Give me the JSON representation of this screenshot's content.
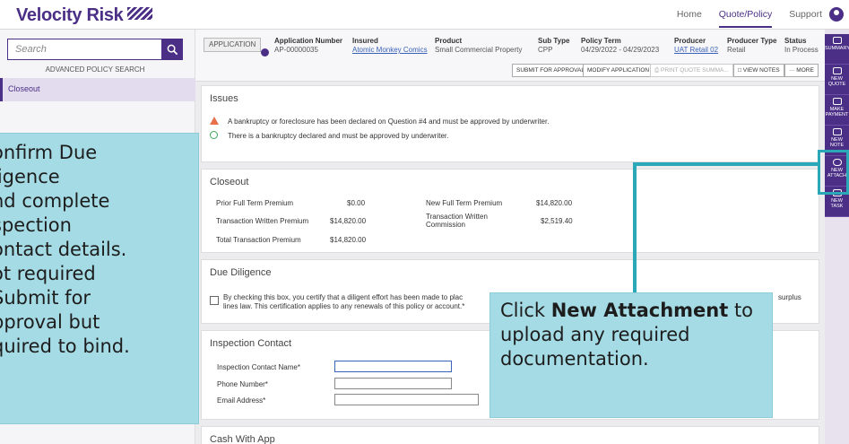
{
  "brand": {
    "name": "Velocity Risk"
  },
  "topnav": {
    "home": "Home",
    "quote_policy": "Quote/Policy",
    "support": "Support"
  },
  "sidebar": {
    "search_placeholder": "Search",
    "advanced_search": "ADVANCED POLICY SEARCH",
    "items": [
      {
        "label": "Closeout"
      }
    ]
  },
  "header": {
    "badge": "APPLICATION",
    "application_number": {
      "label": "Application Number",
      "value": "AP-00000035"
    },
    "insured": {
      "label": "Insured",
      "value": "Atomic Monkey Comics"
    },
    "product": {
      "label": "Product",
      "value": "Small Commercial Property"
    },
    "sub_type": {
      "label": "Sub Type",
      "value": "CPP"
    },
    "policy_term": {
      "label": "Policy Term",
      "value": "04/29/2022 - 04/29/2023"
    },
    "producer": {
      "label": "Producer",
      "value": "UAT Retail 02"
    },
    "producer_type": {
      "label": "Producer Type",
      "value": "Retail"
    },
    "status": {
      "label": "Status",
      "value": "In Process"
    }
  },
  "actions": {
    "submit": "SUBMIT FOR APPROVAL",
    "modify": "MODIFY APPLICATION",
    "print": "PRINT QUOTE SUMMA...",
    "view_notes": "VIEW NOTES",
    "more": "··· MORE"
  },
  "issues": {
    "title": "Issues",
    "items": [
      {
        "type": "warning",
        "text": "A bankruptcy or foreclosure has been declared on Question #4 and must be approved by underwriter."
      },
      {
        "type": "ok",
        "text": "There is a bankruptcy declared and must be approved by underwriter."
      }
    ]
  },
  "closeout": {
    "title": "Closeout",
    "prior_full_term_premium": {
      "label": "Prior Full Term Premium",
      "value": "$0.00"
    },
    "transaction_written_premium": {
      "label": "Transaction Written Premium",
      "value": "$14,820.00"
    },
    "total_transaction_premium": {
      "label": "Total Transaction Premium",
      "value": "$14,820.00"
    },
    "new_full_term_premium": {
      "label": "New Full Term Premium",
      "value": "$14,820.00"
    },
    "transaction_written_commission": {
      "label": "Transaction Written Commission",
      "value": "$2,519.40"
    }
  },
  "due_diligence": {
    "title": "Due Diligence",
    "text_start": "By checking this box, you certify that a diligent effort has been made to plac",
    "text_line2": "lines law. This certification applies to any renewals of this policy or account.*",
    "text_end": "surplus"
  },
  "inspection_contact": {
    "title": "Inspection Contact",
    "name_label": "Inspection Contact Name*",
    "phone_label": "Phone Number*",
    "email_label": "Email Address*"
  },
  "cash_with_app": {
    "title": "Cash With App"
  },
  "rail": {
    "items": [
      {
        "label": "SUMMARY"
      },
      {
        "label": "NEW QUOTE"
      },
      {
        "label": "MAKE PAYMENT"
      },
      {
        "label": "NEW NOTE"
      },
      {
        "label": "NEW ATTACH"
      },
      {
        "label": "NEW TASK"
      }
    ]
  },
  "callouts": {
    "left": "onfirm Due\nligence\nnd complete\nspection\nontact details.\not required\n Submit for\npproval but\nquired to bind.",
    "right_prefix": "Click ",
    "right_bold": "New Attachment",
    "right_suffix": " to upload any required documentation."
  },
  "colors": {
    "brand": "#4b2f86",
    "callout_bg": "#a5dbe5",
    "callout_accent": "#2aa8b8",
    "link": "#3a62b8",
    "warning": "#e8704a",
    "ok": "#3aa55b"
  }
}
